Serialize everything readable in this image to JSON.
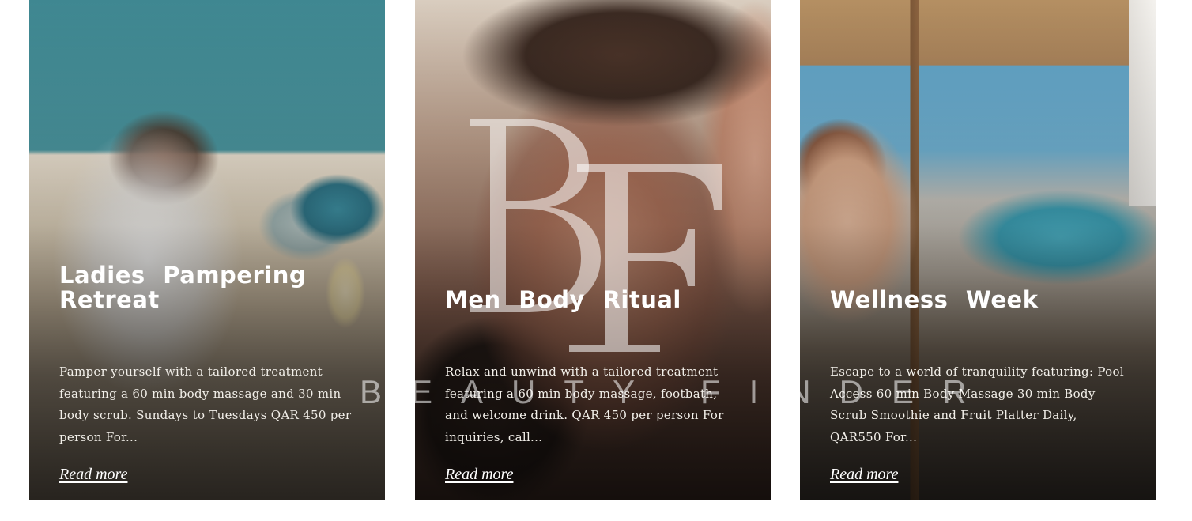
{
  "cards": [
    {
      "title": "Ladies Pampering Retreat",
      "description": "Pamper yourself with a tailored treatment featuring a 60 min body massage and 30 min body scrub. Sundays to Tuesdays QAR 450 per person For...",
      "link_label": "Read more"
    },
    {
      "title": "Men Body Ritual",
      "description": "Relax and unwind with a tailored treatment featuring a 60 min body massage, footbath, and welcome drink. QAR 450 per person For inquiries, call...",
      "link_label": "Read more"
    },
    {
      "title": "Wellness Week",
      "description": "Escape to a world of tranquility featuring: Pool Access 60 min Body Massage 30 min Body Scrub Smoothie and Fruit Platter Daily, QAR550 For...",
      "link_label": "Read more"
    }
  ],
  "watermark": {
    "monogram": "BF",
    "wordmark": "BEAUTY FINDER"
  },
  "colors": {
    "text": "#ffffff",
    "page_background": "#ffffff"
  }
}
